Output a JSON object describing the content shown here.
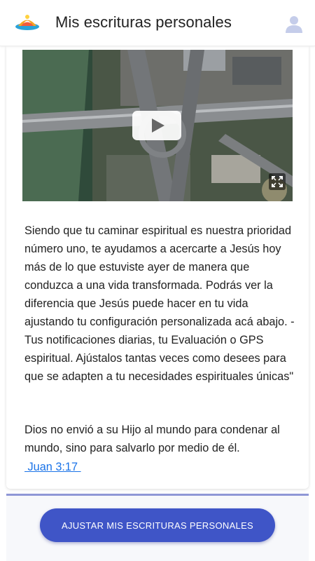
{
  "app_bar": {
    "title": "Mis escrituras personales",
    "logo_icon": "dove-sunrise-logo-icon",
    "profile_icon": "user-avatar-icon"
  },
  "video": {
    "play_icon": "play-icon",
    "fullscreen_icon": "fullscreen-icon"
  },
  "content": {
    "paragraph": "Siendo que tu caminar espiritual es nuestra prioridad número uno, te ayudamos a acercarte a Jesús hoy más de lo que estuviste ayer de manera que conduzca a una vida transformada. Podrás ver la diferencia que Jesús puede hacer en tu vida ajustando tu configuración personalizada acá abajo. - Tus notificaciones diarias, tu Evaluación o GPS espiritual. Ajústalos tantas veces como desees para que se adapten a tu necesidades espirituales únicas\"",
    "verse": "Dios no envió a su Hijo al mundo para condenar al mundo, sino para salvarlo por medio de él.",
    "verse_reference": " Juan 3:17 "
  },
  "cta": {
    "label": "AJUSTAR MIS ESCRITURAS PERSONALES"
  },
  "colors": {
    "accent": "#3f55c7",
    "link": "#1a73e8",
    "panel_border": "#8f97d6"
  }
}
